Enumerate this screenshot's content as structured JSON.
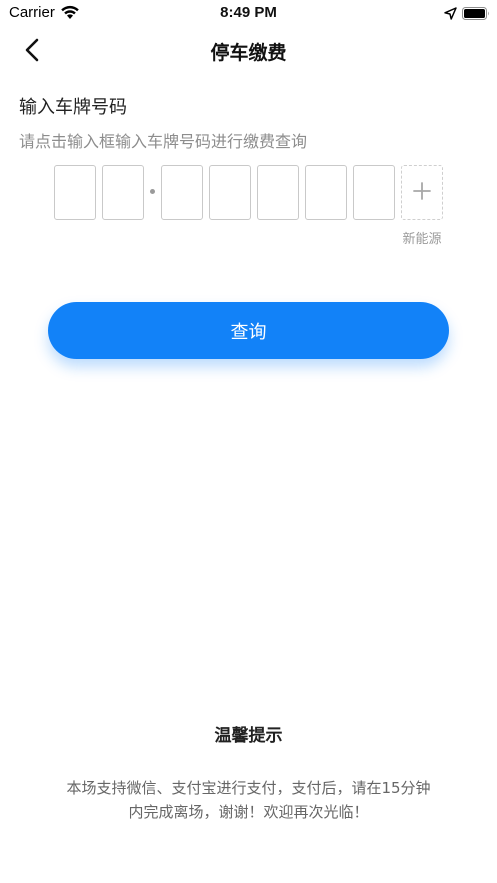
{
  "status_bar": {
    "carrier": "Carrier",
    "time": "8:49 PM",
    "icons": [
      "wifi-icon",
      "location-arrow-icon",
      "battery-icon"
    ]
  },
  "nav": {
    "title": "停车缴费",
    "back_icon": "chevron-left-icon"
  },
  "plate_section": {
    "title": "输入车牌号码",
    "hint": "请点击输入框输入车牌号码进行缴费查询",
    "slots": [
      "",
      "",
      "",
      "",
      "",
      "",
      ""
    ],
    "new_energy_label": "新能源",
    "new_energy_icon": "plus-icon"
  },
  "query_button": {
    "label": "查询"
  },
  "tips": {
    "title": "温馨提示",
    "body": "本场支持微信、支付宝进行支付，支付后，请在15分钟内完成离场，谢谢！欢迎再次光临！"
  },
  "colors": {
    "accent": "#1282f8",
    "hint_text": "#8d8d8d",
    "border": "#c9c9c9"
  }
}
